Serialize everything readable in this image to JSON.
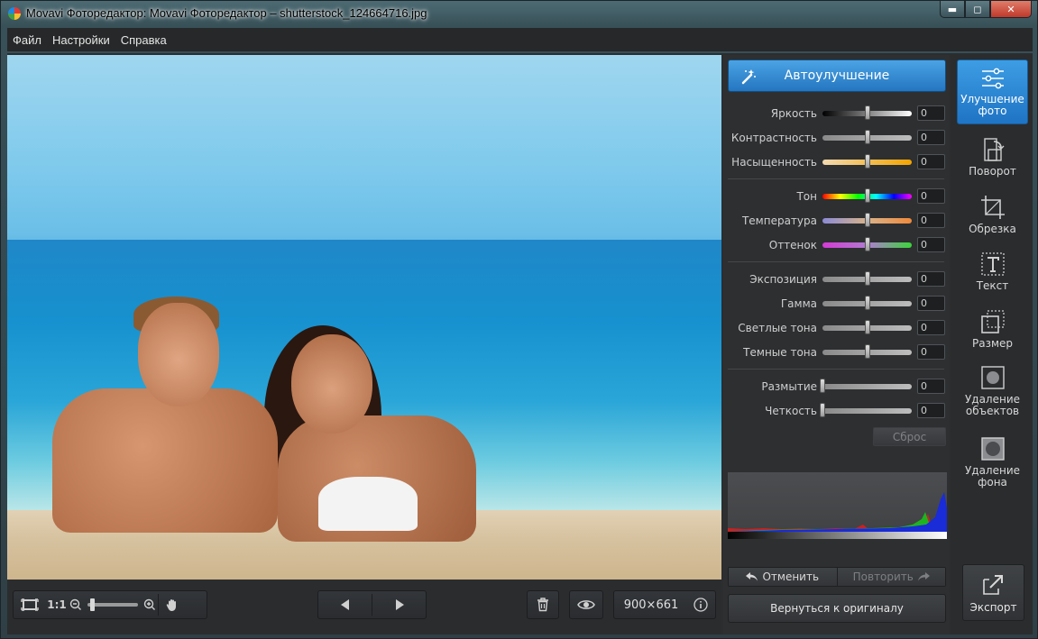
{
  "window": {
    "title": "Movavi Фоторедактор: Movavi Фоторедактор – shutterstock_124664716.jpg",
    "controls": {
      "minimize": "▬",
      "maximize": "◻",
      "close": "✕"
    }
  },
  "menu": [
    "Файл",
    "Настройки",
    "Справка"
  ],
  "panel": {
    "auto_label": "Автоулучшение",
    "groups": [
      [
        {
          "label": "Яркость",
          "value": "0",
          "track": "linear-gradient(to right,#000,#fff)",
          "pos": 0.5
        },
        {
          "label": "Контрастность",
          "value": "0",
          "track": "linear-gradient(to right,#8a8a8a,#bdbdbd)",
          "pos": 0.5
        },
        {
          "label": "Насыщенность",
          "value": "0",
          "track": "linear-gradient(to right,#f2d9b0,#f3a500)",
          "pos": 0.5
        }
      ],
      [
        {
          "label": "Тон",
          "value": "0",
          "track": "linear-gradient(to right,#f00,#ff0,#0f0,#0ff,#00f,#f0f)",
          "pos": 0.5
        },
        {
          "label": "Температура",
          "value": "0",
          "track": "linear-gradient(to right,#8b8bd6,#d8b38a,#f08a3b)",
          "pos": 0.5
        },
        {
          "label": "Оттенок",
          "value": "0",
          "track": "linear-gradient(to right,#d63ad6,#b07bd1,#3ad63a)",
          "pos": 0.5
        }
      ],
      [
        {
          "label": "Экспозиция",
          "value": "0",
          "track": "linear-gradient(to right,#8a8a8a,#bdbdbd)",
          "pos": 0.5
        },
        {
          "label": "Гамма",
          "value": "0",
          "track": "linear-gradient(to right,#8a8a8a,#bdbdbd)",
          "pos": 0.5
        },
        {
          "label": "Светлые тона",
          "value": "0",
          "track": "linear-gradient(to right,#8a8a8a,#bdbdbd)",
          "pos": 0.5
        },
        {
          "label": "Темные тона",
          "value": "0",
          "track": "linear-gradient(to right,#8a8a8a,#bdbdbd)",
          "pos": 0.5
        }
      ],
      [
        {
          "label": "Размытие",
          "value": "0",
          "track": "linear-gradient(to right,#8a8a8a,#bdbdbd)",
          "pos": 0
        },
        {
          "label": "Четкость",
          "value": "0",
          "track": "linear-gradient(to right,#8a8a8a,#bdbdbd)",
          "pos": 0
        }
      ]
    ],
    "reset_label": "Сброс",
    "undo_label": "Отменить",
    "redo_label": "Повторить",
    "revert_label": "Вернуться к оригиналу"
  },
  "tools": [
    {
      "name": "tool-enhance",
      "icon": "sliders-icon",
      "line1": "Улучшение",
      "line2": "фото",
      "active": true
    },
    {
      "name": "tool-rotate",
      "icon": "rotate-icon",
      "line1": "Поворот",
      "line2": "",
      "active": false
    },
    {
      "name": "tool-crop",
      "icon": "crop-icon",
      "line1": "Обрезка",
      "line2": "",
      "active": false
    },
    {
      "name": "tool-text",
      "icon": "text-icon",
      "line1": "Текст",
      "line2": "",
      "active": false
    },
    {
      "name": "tool-resize",
      "icon": "resize-icon",
      "line1": "Размер",
      "line2": "",
      "active": false
    },
    {
      "name": "tool-object-removal",
      "icon": "object-removal-icon",
      "line1": "Удаление",
      "line2": "объектов",
      "active": false
    },
    {
      "name": "tool-background-removal",
      "icon": "background-removal-icon",
      "line1": "Удаление",
      "line2": "фона",
      "active": false
    }
  ],
  "export_label": "Экспорт",
  "bottom": {
    "zoom_1to1": "1:1",
    "zoom_level": 0.05,
    "dimensions": "900×661"
  },
  "colors": {
    "accent": "#2b86d1"
  }
}
